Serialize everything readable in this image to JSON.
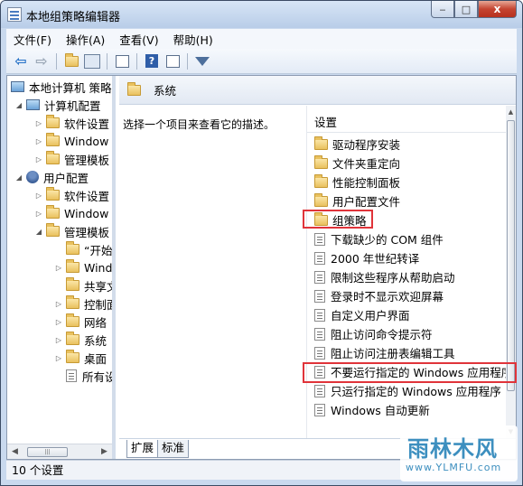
{
  "window": {
    "title": "本地组策略编辑器",
    "minimize": "‒",
    "maximize": "□",
    "close": "x"
  },
  "menu": [
    {
      "label": "文件(F)"
    },
    {
      "label": "操作(A)"
    },
    {
      "label": "查看(V)"
    },
    {
      "label": "帮助(H)"
    }
  ],
  "toolbar": {
    "help_glyph": "?"
  },
  "tree": {
    "items": [
      {
        "label": "本地计算机 策略",
        "icon": "computer-policy-icon"
      },
      {
        "label": "计算机配置",
        "toggle": "◢",
        "icon": "computer-icon"
      },
      {
        "label": "软件设置",
        "toggle": "▷",
        "icon": "folder-icon"
      },
      {
        "label": "Window",
        "toggle": "▷",
        "icon": "folder-icon"
      },
      {
        "label": "管理模板",
        "toggle": "▷",
        "icon": "folder-icon"
      },
      {
        "label": "用户配置",
        "toggle": "◢",
        "icon": "user-icon"
      },
      {
        "label": "软件设置",
        "toggle": "▷",
        "icon": "folder-icon"
      },
      {
        "label": "Window",
        "toggle": "▷",
        "icon": "folder-icon"
      },
      {
        "label": "管理模板",
        "toggle": "◢",
        "icon": "folder-icon"
      },
      {
        "label": "“开始",
        "toggle": "",
        "icon": "folder-icon"
      },
      {
        "label": "Wind",
        "toggle": "▷",
        "icon": "folder-icon"
      },
      {
        "label": "共享文",
        "toggle": "",
        "icon": "folder-icon"
      },
      {
        "label": "控制面",
        "toggle": "▷",
        "icon": "folder-icon"
      },
      {
        "label": "网络",
        "toggle": "▷",
        "icon": "folder-icon"
      },
      {
        "label": "系统",
        "toggle": "▷",
        "icon": "folder-icon"
      },
      {
        "label": "桌面",
        "toggle": "▷",
        "icon": "folder-icon"
      },
      {
        "label": "所有设",
        "toggle": "",
        "icon": "all-settings-icon"
      }
    ]
  },
  "header": {
    "title": "系统"
  },
  "description": {
    "text": "选择一个项目来查看它的描述。"
  },
  "list": {
    "column": "设置",
    "items": [
      {
        "label": "驱动程序安装",
        "icon": "folder-icon"
      },
      {
        "label": "文件夹重定向",
        "icon": "folder-icon"
      },
      {
        "label": "性能控制面板",
        "icon": "folder-icon"
      },
      {
        "label": "用户配置文件",
        "icon": "folder-icon"
      },
      {
        "label": "组策略",
        "icon": "folder-icon"
      },
      {
        "label": "下载缺少的 COM 组件",
        "icon": "setting-icon"
      },
      {
        "label": "2000 年世纪转译",
        "icon": "setting-icon"
      },
      {
        "label": "限制这些程序从帮助启动",
        "icon": "setting-icon"
      },
      {
        "label": "登录时不显示欢迎屏幕",
        "icon": "setting-icon"
      },
      {
        "label": "自定义用户界面",
        "icon": "setting-icon"
      },
      {
        "label": "阻止访问命令提示符",
        "icon": "setting-icon"
      },
      {
        "label": "阻止访问注册表编辑工具",
        "icon": "setting-icon"
      },
      {
        "label": "不要运行指定的 Windows 应用程序",
        "icon": "setting-icon"
      },
      {
        "label": "只运行指定的 Windows 应用程序",
        "icon": "setting-icon"
      },
      {
        "label": "Windows 自动更新",
        "icon": "setting-icon"
      }
    ]
  },
  "tabs": [
    {
      "label": "扩展"
    },
    {
      "label": "标准"
    }
  ],
  "status": {
    "text": "10 个设置"
  },
  "watermark": {
    "text": "雨林木风",
    "url": "www.YLMFU.com"
  },
  "colors": {
    "highlight": "#e0343a",
    "accent": "#2c76c9"
  }
}
